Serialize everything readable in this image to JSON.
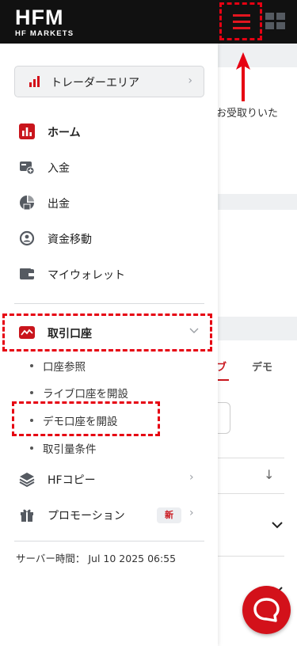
{
  "header": {
    "logo_text": "HFM",
    "logo_subtext": "HF MARKETS"
  },
  "drawer": {
    "trader_area_label": "トレーダーエリア",
    "nav": {
      "home": "ホーム",
      "deposit": "入金",
      "withdraw": "出金",
      "transfer": "資金移動",
      "wallet": "マイウォレット",
      "trading_accounts": "取引口座",
      "hf_copy": "HFコピー",
      "promotions": "プロモーション"
    },
    "trading_sub": {
      "view": "口座参照",
      "open_live": "ライブ口座を開設",
      "open_demo": "デモ口座を開設",
      "conditions": "取引量条件"
    },
    "new_badge": "新",
    "server_time": "サーバー時間： Jul 10 2025 06:55"
  },
  "background": {
    "partial_text": "お受取りいた",
    "tab_live": "ブ",
    "tab_demo": "デモ"
  },
  "colors": {
    "brand_red": "#d3111a",
    "annotation_red": "#e60012",
    "header_bg": "#111111"
  },
  "icons": [
    "bar-chart-icon",
    "deposit-icon",
    "withdraw-icon",
    "transfer-icon",
    "wallet-icon",
    "trading-account-icon",
    "layers-icon",
    "gift-icon",
    "chevron-right-icon",
    "chevron-down-icon",
    "chat-icon",
    "hamburger-menu-icon",
    "grid-icon"
  ]
}
